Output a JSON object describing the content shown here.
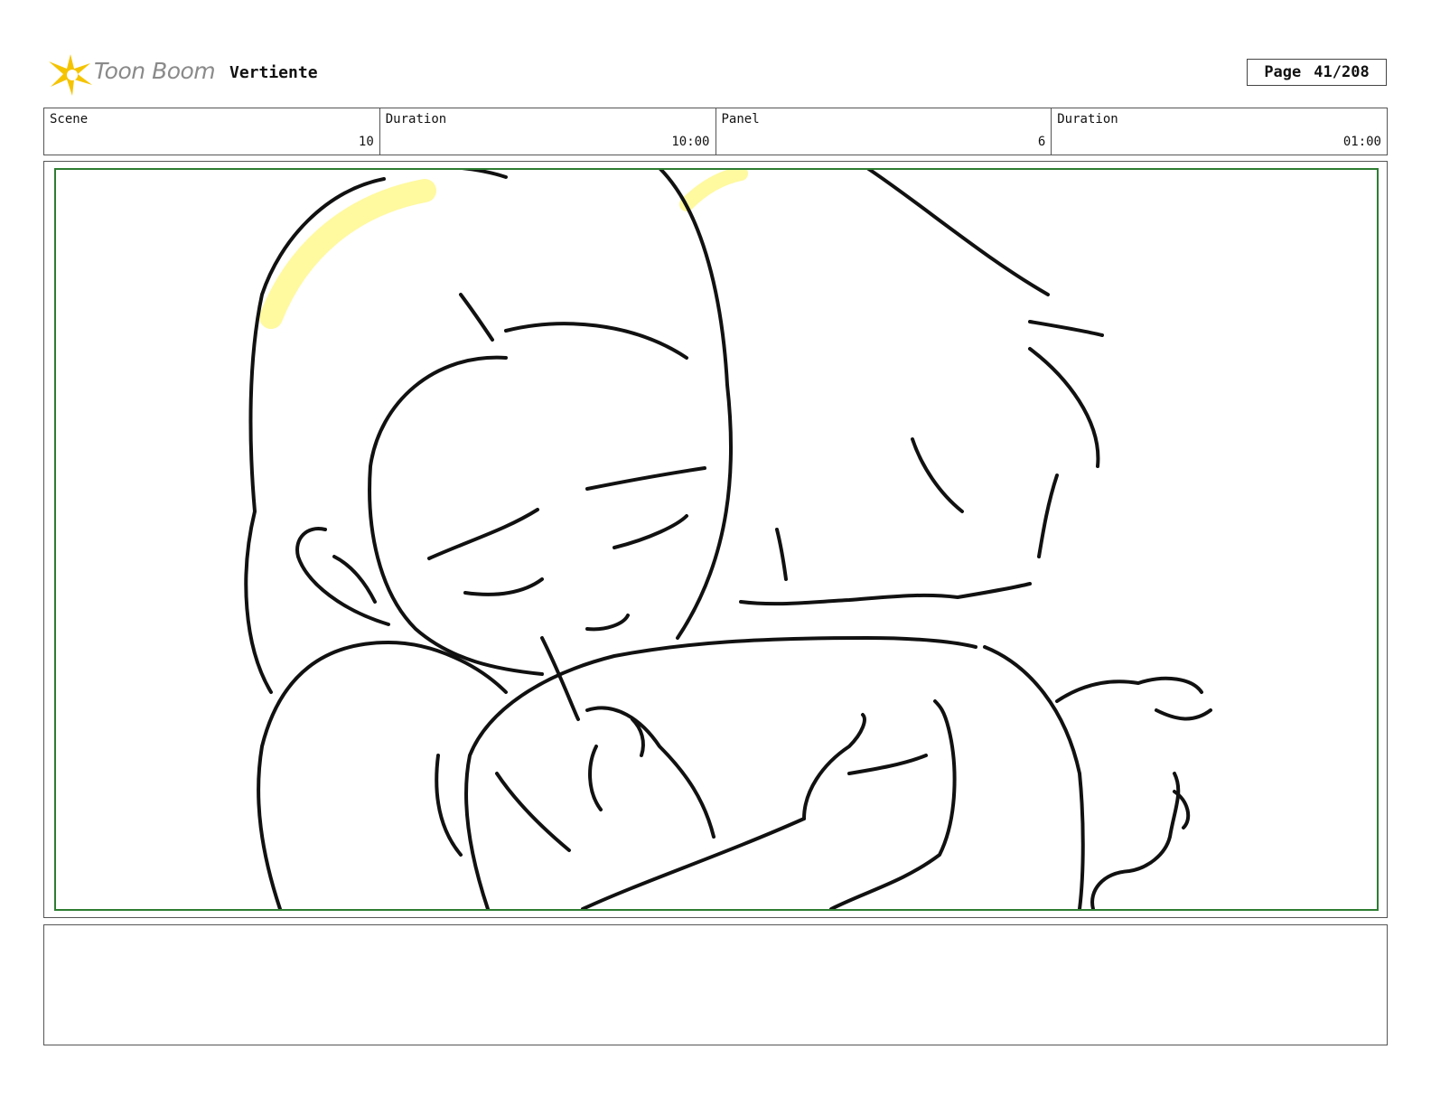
{
  "header": {
    "logo_text": "Toon Boom",
    "project_title": "Vertiente",
    "page_label": "Page",
    "page_value": "41/208"
  },
  "info": [
    {
      "label": "Scene",
      "value": "10"
    },
    {
      "label": "Duration",
      "value": "10:00"
    },
    {
      "label": "Panel",
      "value": "6"
    },
    {
      "label": "Duration",
      "value": "01:00"
    }
  ],
  "colors": {
    "safe_area": "#2e7d32",
    "highlight": "#fff9a0",
    "logo_accent": "#f5c400"
  },
  "notes": {
    "text": ""
  }
}
